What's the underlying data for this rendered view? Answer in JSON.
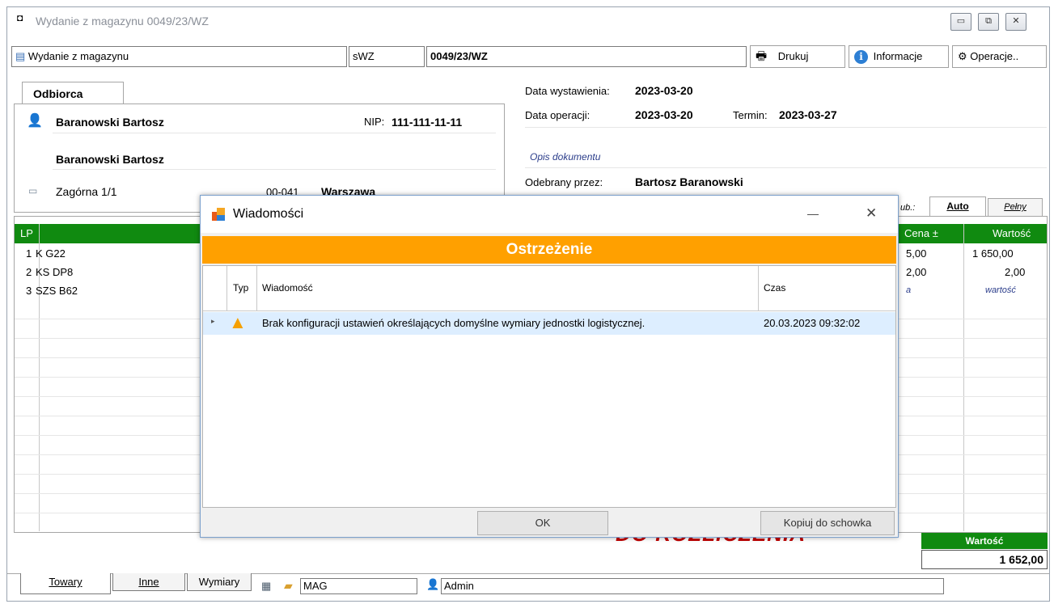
{
  "window": {
    "title": "Wydanie z magazynu 0049/23/WZ",
    "controls": {
      "minimize": "▭",
      "restore": "⧉",
      "close": "✕"
    }
  },
  "toolbar": {
    "doc_type": "Wydanie z magazynu",
    "series": "sWZ",
    "number": "0049/23/WZ",
    "print": "Drukuj",
    "info": "Informacje",
    "operations": "Operacje.."
  },
  "recipient": {
    "tab": "Odbiorca",
    "name1": "Baranowski Bartosz",
    "nip_label": "NIP:",
    "nip": "111-111-11-11",
    "name2": "Baranowski Bartosz",
    "street": "Zagórna 1/1",
    "postcode": "00-041",
    "city": "Warszawa"
  },
  "doc_info": {
    "issue_label": "Data wystawienia:",
    "issue_date": "2023-03-20",
    "op_label": "Data operacji:",
    "op_date": "2023-03-20",
    "term_label": "Termin:",
    "term_date": "2023-03-27",
    "description": "Opis dokumentu",
    "received_label": "Odebrany przez:",
    "received_by": "Bartosz Baranowski"
  },
  "view_tabs": {
    "partial": "ub.:",
    "auto": "Auto",
    "full": "Pełny"
  },
  "items_table": {
    "col_lp": "LP",
    "col_price": "Cena ±",
    "col_value": "Wartość",
    "rows": [
      {
        "lp": "1",
        "name": "K G22",
        "price": "5,00",
        "value": "1 650,00"
      },
      {
        "lp": "2",
        "name": "KS DP8",
        "price": "2,00",
        "value": "2,00"
      },
      {
        "lp": "3",
        "name": "SZS B62",
        "price": "a",
        "value": "wartość"
      }
    ]
  },
  "footer": {
    "stamp": "DO ROZLICZENIA",
    "total_label": "Wartość",
    "total_value": "1 652,00"
  },
  "bottom_bar": {
    "tab_goods": "Towary",
    "tab_other": "Inne",
    "tab_dims": "Wymiary",
    "warehouse": "MAG",
    "user": "Admin"
  },
  "dialog": {
    "title": "Wiadomości",
    "minimize": "—",
    "close": "✕",
    "banner": "Ostrzeżenie",
    "col_type": "Typ",
    "col_message": "Wiadomość",
    "col_time": "Czas",
    "rows": [
      {
        "message": "Brak konfiguracji ustawień określających domyślne wymiary jednostki logistycznej.",
        "time": "20.03.2023 09:32:02"
      }
    ],
    "ok": "OK",
    "copy": "Kopiuj do schowka"
  },
  "colors": {
    "green_header": "#108a10",
    "warning_orange": "#ffa000",
    "stamp_red": "#c00000"
  }
}
